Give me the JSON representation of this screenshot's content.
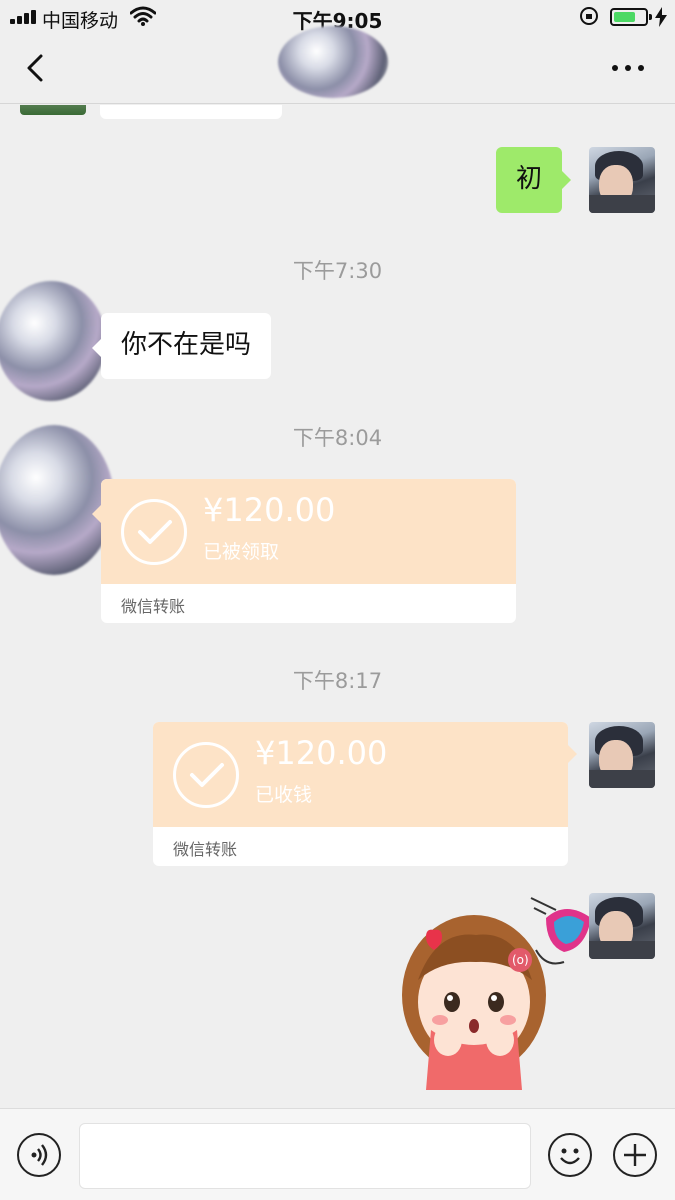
{
  "status_bar": {
    "carrier": "中国移动",
    "time": "下午9:05",
    "battery_level_pct": 70,
    "icons": [
      "signal-icon",
      "wifi-icon",
      "orientation-lock-icon",
      "battery-icon",
      "charging-icon"
    ]
  },
  "nav": {
    "icons": [
      "back-icon",
      "more-icon"
    ]
  },
  "messages": {
    "m1_text": "初",
    "t1": "下午7:30",
    "m2_text": "你不在是吗",
    "t2": "下午8:04",
    "transfer1": {
      "amount": "¥120.00",
      "status": "已被领取",
      "label": "微信转账"
    },
    "t3": "下午8:17",
    "transfer2": {
      "amount": "¥120.00",
      "status": "已收钱",
      "label": "微信转账"
    }
  },
  "input_bar": {
    "icons": [
      "voice-icon",
      "emoji-icon",
      "plus-icon"
    ]
  },
  "colors": {
    "bubble_out": "#9eea6a",
    "bubble_in": "#ffffff",
    "transfer": "#fde3c7",
    "background": "#efefef"
  }
}
